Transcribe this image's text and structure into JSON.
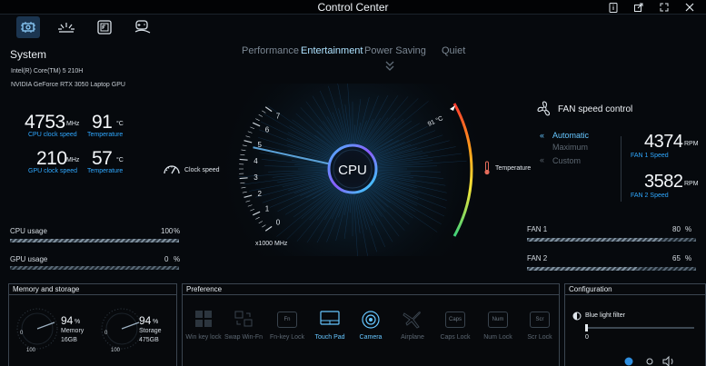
{
  "app": {
    "title": "Control Center"
  },
  "modes": [
    {
      "label": "Performance",
      "active": false
    },
    {
      "label": "Entertainment",
      "active": true
    },
    {
      "label": "Power Saving",
      "active": false
    },
    {
      "label": "Quiet",
      "active": false
    }
  ],
  "system": {
    "title": "System",
    "cpu_name": "Intel(R) Core(TM) 5 210H",
    "gpu_name": "NVIDIA GeForce RTX 3050 Laptop GPU",
    "cpu_clock": {
      "value": "4753",
      "unit": "MHz",
      "label": "CPU clock speed"
    },
    "cpu_temp": {
      "value": "91",
      "unit": "°C",
      "label": "Temperature"
    },
    "gpu_clock": {
      "value": "210",
      "unit": "MHz",
      "label": "GPU clock speed"
    },
    "gpu_temp": {
      "value": "57",
      "unit": "°C",
      "label": "Temperature"
    }
  },
  "usage": {
    "cpu": {
      "label": "CPU usage",
      "value": "100",
      "unit": "%",
      "fraction": 1.0
    },
    "gpu": {
      "label": "GPU usage",
      "value": "0",
      "unit": "%",
      "fraction": 0.0
    }
  },
  "gauge": {
    "center_label": "CPU",
    "clock_label": "Clock speed",
    "temp_label": "Temperature",
    "scale_unit": "x1000 MHz",
    "ticks": [
      "0",
      "1",
      "2",
      "3",
      "4",
      "5",
      "6",
      "7"
    ],
    "temp_reading": "91 °C",
    "clock_value_ghz": 4.753
  },
  "fan": {
    "title": "FAN speed control",
    "modes": [
      {
        "label": "Automatic",
        "active": true
      },
      {
        "label": "Maximum",
        "active": false
      },
      {
        "label": "Custom",
        "active": false
      }
    ],
    "fan1": {
      "rpm": "4374",
      "unit": "RPM",
      "label": "FAN 1 Speed",
      "usage_label": "FAN 1",
      "usage_value": "80",
      "usage_unit": "%",
      "fraction": 0.8
    },
    "fan2": {
      "rpm": "3582",
      "unit": "RPM",
      "label": "FAN 2 Speed",
      "usage_label": "FAN 2",
      "usage_value": "65",
      "usage_unit": "%",
      "fraction": 0.65
    }
  },
  "memory_panel": {
    "title": "Memory and storage",
    "memory": {
      "percent": "94",
      "unit": "%",
      "label": "Memory",
      "size": "16GB",
      "min": "0",
      "max": "100",
      "fraction": 0.94
    },
    "storage": {
      "percent": "94",
      "unit": "%",
      "label": "Storage",
      "size": "475GB",
      "min": "0",
      "max": "100",
      "fraction": 0.94
    }
  },
  "preference": {
    "title": "Preference",
    "items": [
      {
        "label": "Win key lock",
        "icon": "windows-key-icon",
        "keycap": "",
        "active": false
      },
      {
        "label": "Swap Win-Fn",
        "icon": "swap-icon",
        "keycap": "",
        "active": false
      },
      {
        "label": "Fn-key Lock",
        "icon": "fn-key-icon",
        "keycap": "Fn",
        "active": false
      },
      {
        "label": "Touch Pad",
        "icon": "touchpad-icon",
        "keycap": "",
        "active": true
      },
      {
        "label": "Camera",
        "icon": "camera-icon",
        "keycap": "",
        "active": true
      },
      {
        "label": "Airplane",
        "icon": "airplane-icon",
        "keycap": "",
        "active": false
      },
      {
        "label": "Caps Lock",
        "icon": "caps-lock-icon",
        "keycap": "Caps",
        "active": false
      },
      {
        "label": "Num Lock",
        "icon": "num-lock-icon",
        "keycap": "Num",
        "active": false
      },
      {
        "label": "Scr Lock",
        "icon": "scroll-lock-icon",
        "keycap": "Scr",
        "active": false
      }
    ]
  },
  "configuration": {
    "title": "Configuration",
    "blue_light_label": "Blue light filter",
    "slider_min": "0",
    "slider_fraction": 0.0
  },
  "colors": {
    "accent": "#2fa8ff",
    "active_mode": "#aee2ff",
    "background": "#06090d"
  }
}
